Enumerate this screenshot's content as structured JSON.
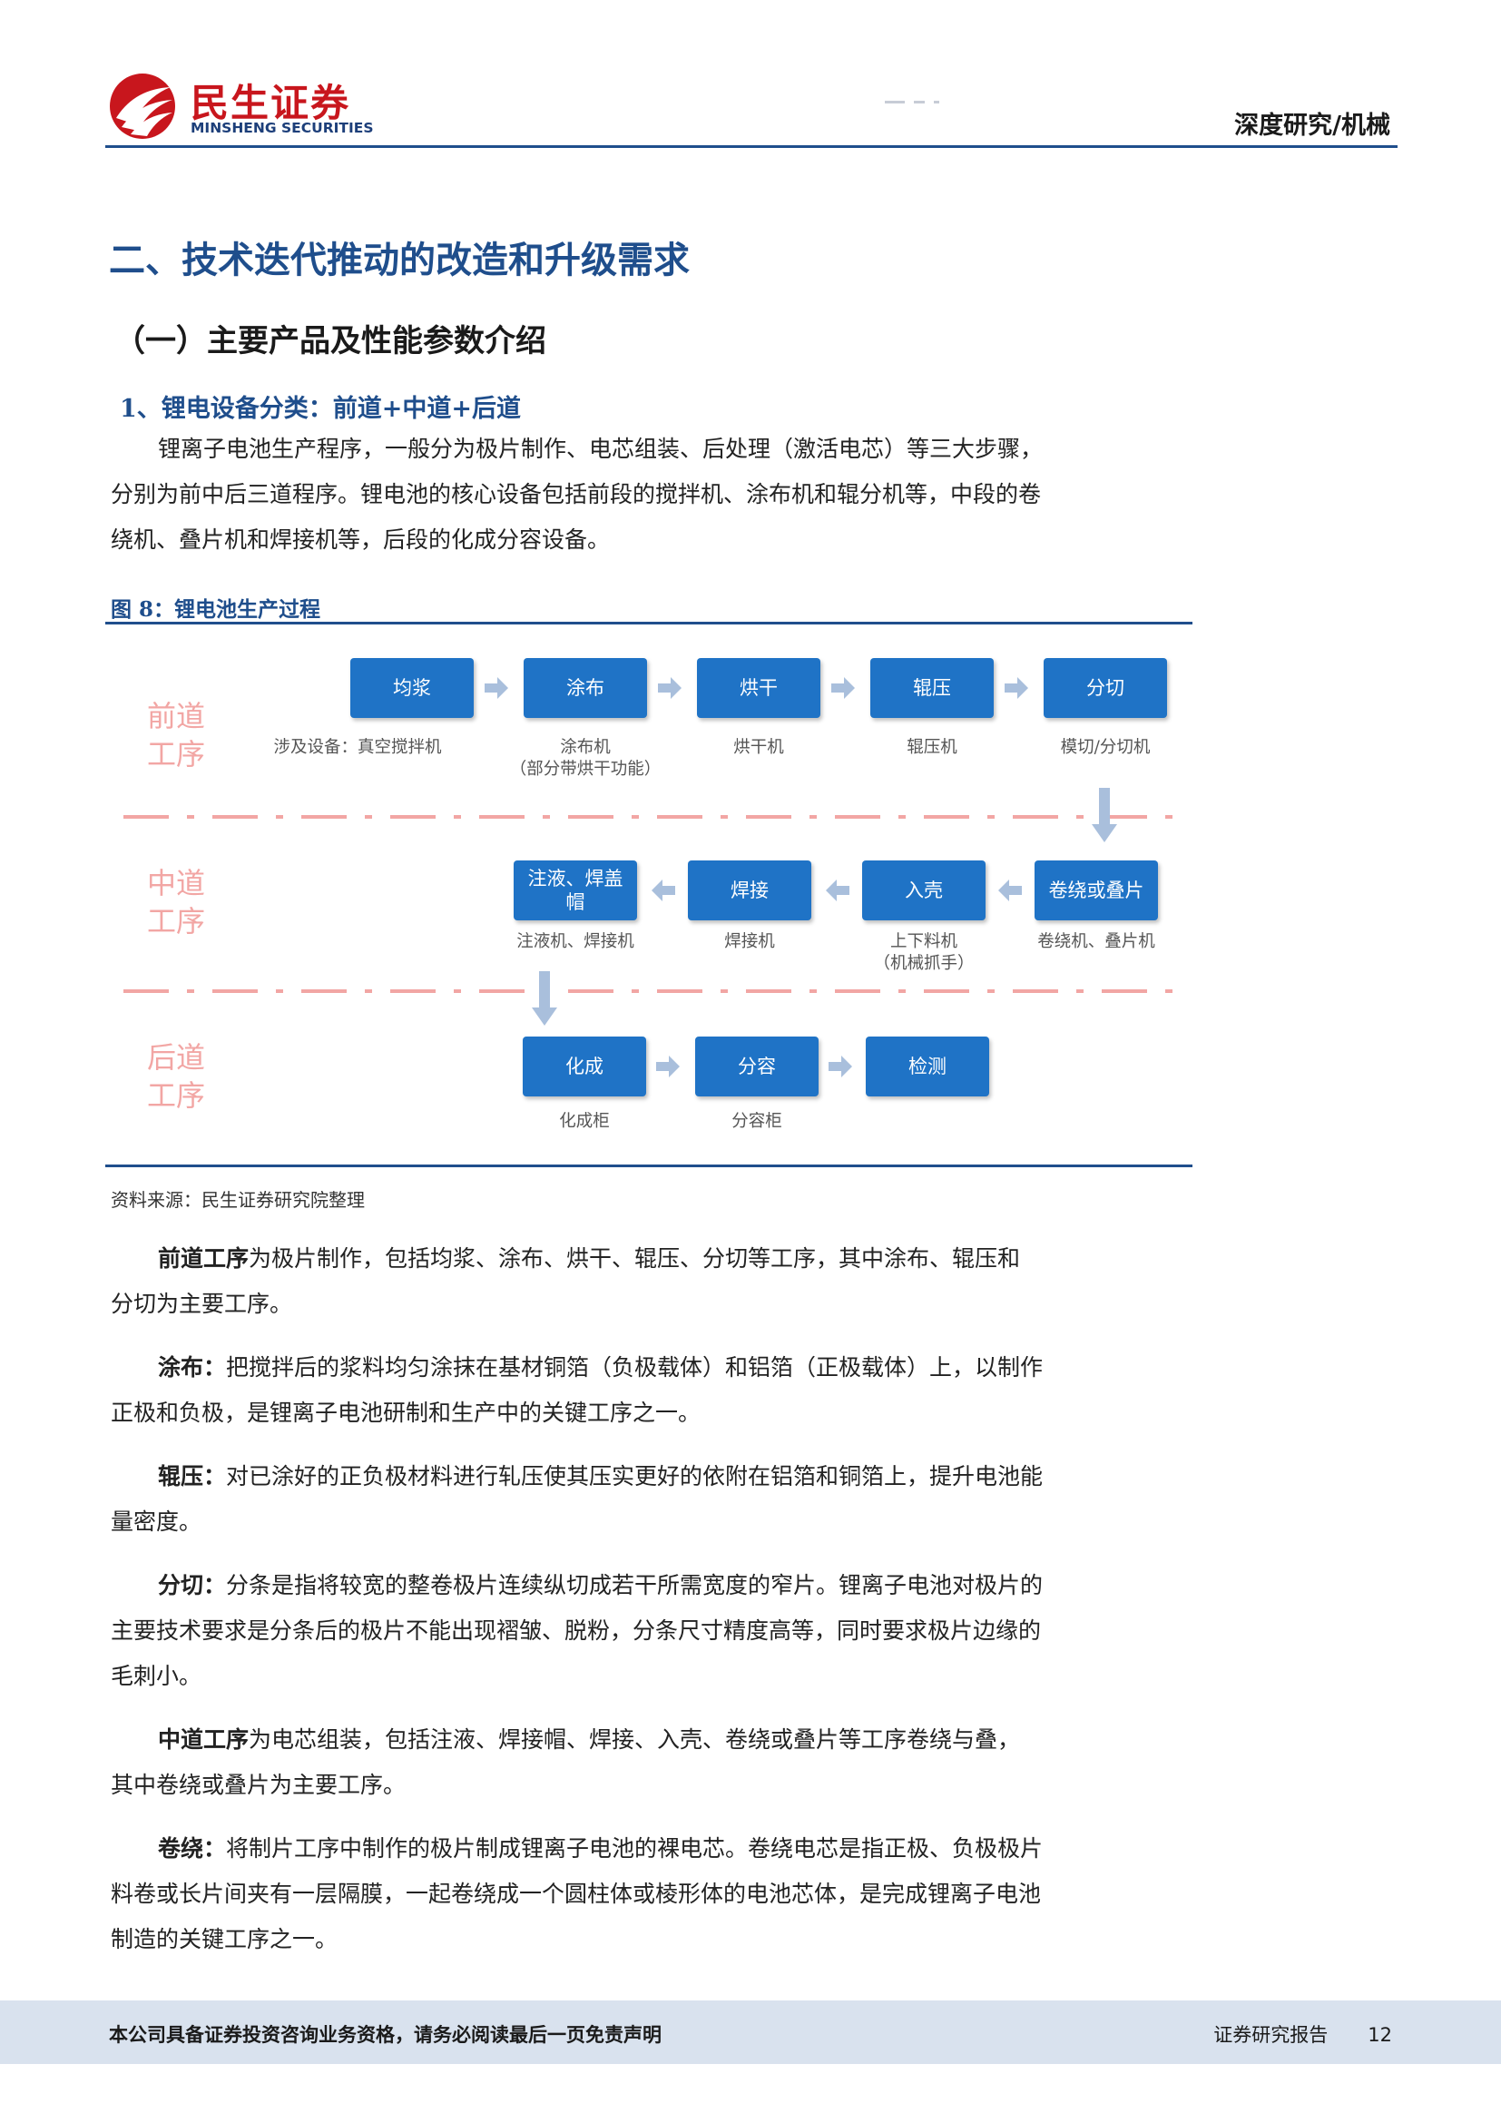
{
  "header": {
    "logo_cn": "民生证券",
    "logo_en": "MINSHENG SECURITIES",
    "category": "深度研究/机械",
    "brand_color": "#c8161d",
    "accent_color": "#1f4e8c"
  },
  "section_title": "二、技术迭代推动的改造和升级需求",
  "subsection_title": "（一）主要产品及性能参数介绍",
  "subsubsection_title": "1、锂电设备分类：前道+中道+后道",
  "intro_lines": [
    "锂离子电池生产程序，一般分为极片制作、电芯组装、后处理（激活电芯）等三大步骤，",
    "分别为前中后三道程序。锂电池的核心设备包括前段的搅拌机、涂布机和辊分机等，中段的卷",
    "绕机、叠片机和焊接机等，后段的化成分容设备。"
  ],
  "figure": {
    "title": "图 8：锂电池生产过程",
    "source": "资料来源：民生证券研究院整理",
    "stages": {
      "front": "前道工序",
      "middle": "中道工序",
      "back": "后道工序"
    },
    "front_boxes": [
      "均浆",
      "涂布",
      "烘干",
      "辊压",
      "分切"
    ],
    "front_equip": [
      "涉及设备：真空搅拌机",
      "涂布机\n（部分带烘干功能）",
      "烘干机",
      "辊压机",
      "模切/分切机"
    ],
    "middle_boxes": [
      "注液、焊盖帽",
      "焊接",
      "入壳",
      "卷绕或叠片"
    ],
    "middle_equip": [
      "注液机、焊接机",
      "焊接机",
      "上下料机\n（机械抓手）",
      "卷绕机、叠片机"
    ],
    "back_boxes": [
      "化成",
      "分容",
      "检测"
    ],
    "back_equip": [
      "化成柜",
      "分容柜",
      ""
    ]
  },
  "paragraphs": [
    {
      "lead": "前道工序",
      "lines": [
        "为极片制作，包括均浆、涂布、烘干、辊压、分切等工序，其中涂布、辊压和",
        "分切为主要工序。"
      ]
    },
    {
      "lead": "涂布：",
      "lines": [
        "把搅拌后的浆料均匀涂抹在基材铜箔（负极载体）和铝箔（正极载体）上，以制作",
        "正极和负极，是锂离子电池研制和生产中的关键工序之一。"
      ]
    },
    {
      "lead": "辊压：",
      "lines": [
        "对已涂好的正负极材料进行轧压使其压实更好的依附在铝箔和铜箔上，提升电池能",
        "量密度。"
      ]
    },
    {
      "lead": "分切：",
      "lines": [
        "分条是指将较宽的整卷极片连续纵切成若干所需宽度的窄片。锂离子电池对极片的",
        "主要技术要求是分条后的极片不能出现褶皱、脱粉，分条尺寸精度高等，同时要求极片边缘的",
        "毛刺小。"
      ]
    },
    {
      "lead": "中道工序",
      "lines": [
        "为电芯组装，包括注液、焊接帽、焊接、入壳、卷绕或叠片等工序卷绕与叠，",
        "其中卷绕或叠片为主要工序。"
      ]
    },
    {
      "lead": "卷绕：",
      "lines": [
        "将制片工序中制作的极片制成锂离子电池的裸电芯。卷绕电芯是指正极、负极极片",
        "料卷或长片间夹有一层隔膜，一起卷绕成一个圆柱体或棱形体的电池芯体，是完成锂离子电池",
        "制造的关键工序之一。"
      ]
    }
  ],
  "footer": {
    "disclaimer": "本公司具备证券投资咨询业务资格，请务必阅读最后一页免责声明",
    "report_type": "证券研究报告",
    "page_number": "12"
  }
}
